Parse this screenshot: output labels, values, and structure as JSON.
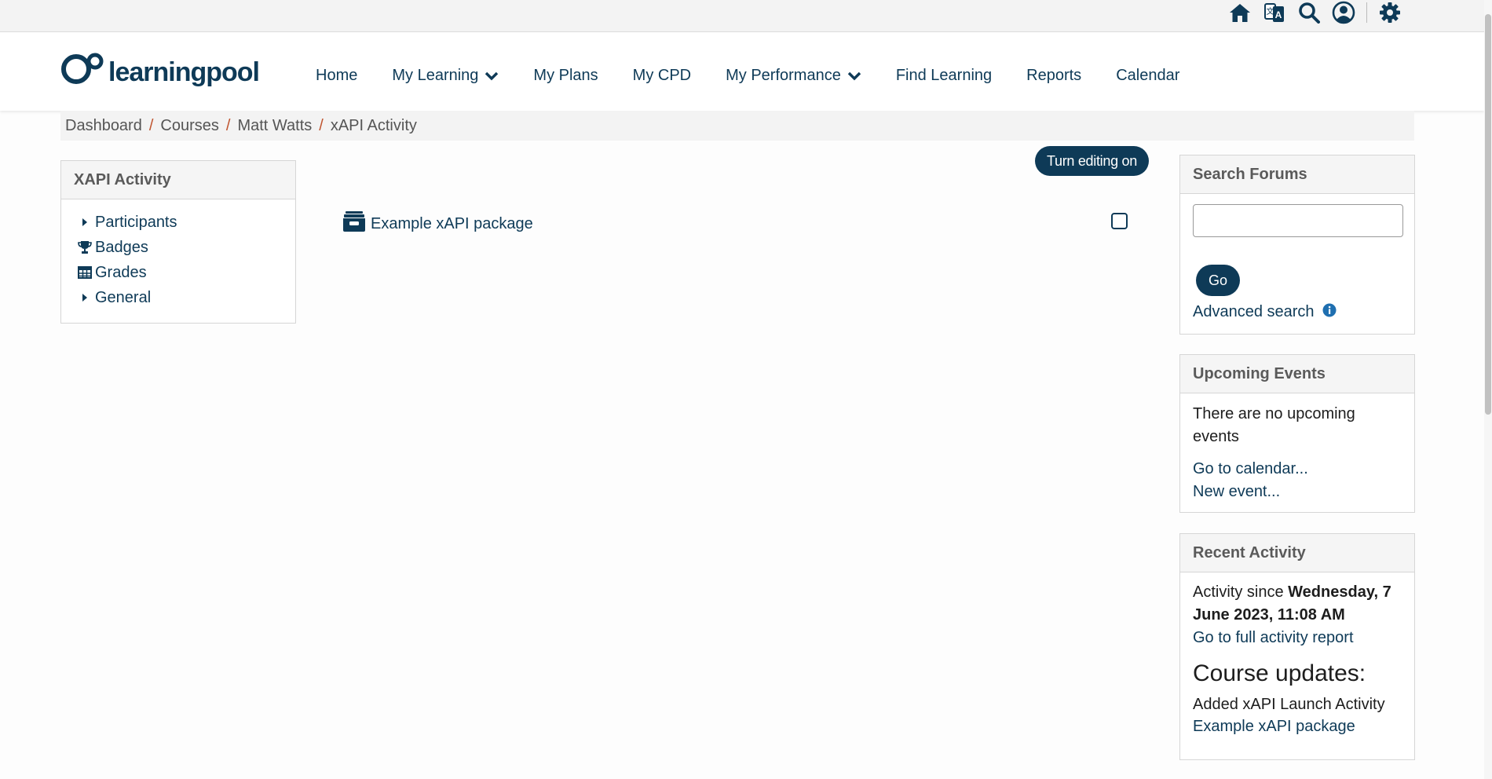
{
  "topbar": {
    "icons": [
      "home-icon",
      "language-icon",
      "search-icon",
      "user-icon",
      "gear-icon"
    ]
  },
  "brand": {
    "logo_text": "learningpool",
    "color": "#0e3a57"
  },
  "nav": {
    "items": [
      {
        "label": "Home"
      },
      {
        "label": "My Learning"
      },
      {
        "label": "My Plans"
      },
      {
        "label": "My CPD"
      },
      {
        "label": "My Performance"
      },
      {
        "label": "Find Learning"
      },
      {
        "label": "Reports"
      },
      {
        "label": "Calendar"
      }
    ]
  },
  "breadcrumb": {
    "items": [
      "Dashboard",
      "Courses",
      "Matt Watts",
      "xAPI Activity"
    ]
  },
  "left_block": {
    "title": "XAPI Activity",
    "items": [
      {
        "label": "Participants",
        "icon": "caret-right-icon"
      },
      {
        "label": "Badges",
        "icon": "trophy-icon"
      },
      {
        "label": "Grades",
        "icon": "table-icon"
      },
      {
        "label": "General",
        "icon": "caret-right-icon"
      }
    ]
  },
  "main": {
    "edit_button": "Turn editing on",
    "activity": {
      "label": "Example xAPI package",
      "icon": "archive-icon"
    }
  },
  "search_forums": {
    "title": "Search Forums",
    "go_label": "Go",
    "advanced_label": "Advanced search"
  },
  "upcoming_events": {
    "title": "Upcoming Events",
    "message": "There are no upcoming events",
    "calendar_link": "Go to calendar...",
    "new_event_link": "New event..."
  },
  "recent_activity": {
    "title": "Recent Activity",
    "since_prefix": "Activity since ",
    "since_date": "Wednesday, 7 June 2023, 11:08 AM",
    "full_report_link": "Go to full activity report",
    "updates_heading": "Course updates:",
    "update_text": "Added xAPI Launch Activity",
    "update_link": "Example xAPI package"
  }
}
